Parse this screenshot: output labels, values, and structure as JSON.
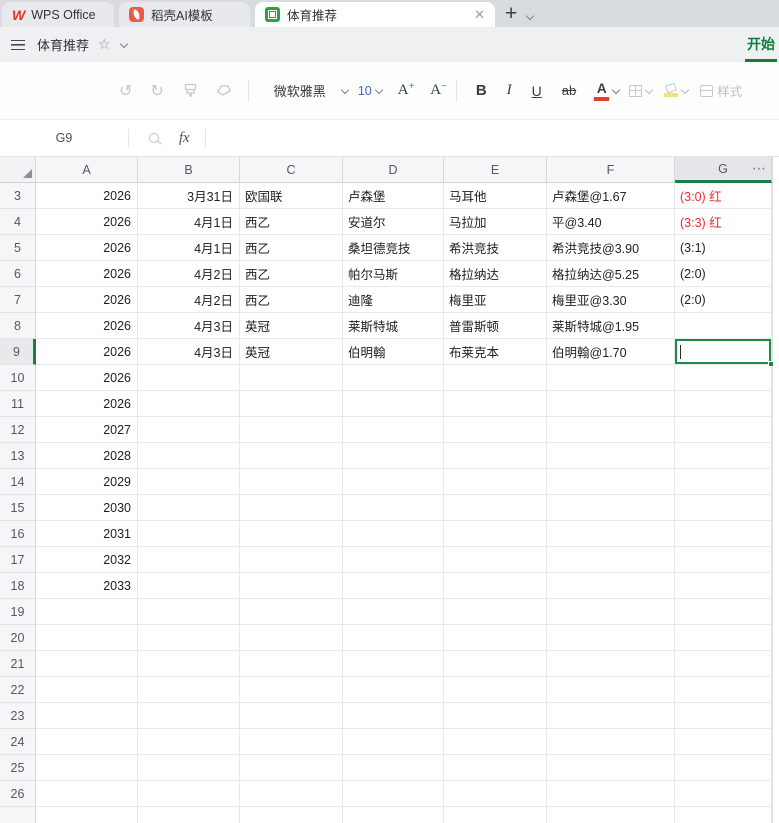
{
  "tabbar": {
    "tabs": [
      {
        "label": "WPS Office",
        "icon": "wps-logo",
        "active": false
      },
      {
        "label": "稻壳AI模板",
        "icon": "docer-template-icon",
        "active": false
      },
      {
        "label": "体育推荐",
        "icon": "spreadsheet-icon",
        "active": true,
        "close_glyph": "✕"
      }
    ],
    "new_tab_glyph": "+"
  },
  "titlebar": {
    "menu_icon": "hamburger",
    "title": "体育推荐",
    "star_glyph": "☆",
    "ribbon_tab": "开始"
  },
  "toolbar": {
    "undo_glyph": "↺",
    "redo_glyph": "↻",
    "font_name": "微软雅黑",
    "font_size": "10",
    "grow_font": "A",
    "grow_sign": "+",
    "shrink_font": "A",
    "shrink_sign": "−",
    "bold": "B",
    "italic": "I",
    "underline": "U",
    "strikethrough": "ab",
    "font_color_letter": "A",
    "font_color": "#e93b2e",
    "fill_color": "#f2e27d",
    "style_label": "样式"
  },
  "formula_bar": {
    "cell_ref": "G9",
    "fx_label": "fx"
  },
  "grid": {
    "columns": [
      "A",
      "B",
      "C",
      "D",
      "E",
      "F",
      "G"
    ],
    "more_button": "⋯",
    "selected_column": "G",
    "selected_cell": "G9",
    "rows": [
      {
        "n": 3,
        "cells": [
          "2026",
          "3月31日",
          "欧国联",
          "卢森堡",
          "马耳他",
          "卢森堡@1.67",
          "(3:0) 红"
        ],
        "result_red": true
      },
      {
        "n": 4,
        "cells": [
          "2026",
          "4月1日",
          "西乙",
          "安道尔",
          "马拉加",
          "平@3.40",
          "(3:3) 红"
        ],
        "result_red": true
      },
      {
        "n": 5,
        "cells": [
          "2026",
          "4月1日",
          "西乙",
          "桑坦德竞技",
          "希洪竞技",
          "希洪竞技@3.90",
          "(3:1)"
        ]
      },
      {
        "n": 6,
        "cells": [
          "2026",
          "4月2日",
          "西乙",
          "帕尔马斯",
          "格拉纳达",
          "格拉纳达@5.25",
          "(2:0)"
        ]
      },
      {
        "n": 7,
        "cells": [
          "2026",
          "4月2日",
          "西乙",
          "迪隆",
          "梅里亚",
          "梅里亚@3.30",
          "(2:0)"
        ]
      },
      {
        "n": 8,
        "cells": [
          "2026",
          "4月3日",
          "英冠",
          "莱斯特城",
          "普雷斯顿",
          "莱斯特城@1.95",
          ""
        ]
      },
      {
        "n": 9,
        "cells": [
          "2026",
          "4月3日",
          "英冠",
          "伯明翰",
          "布莱克本",
          "伯明翰@1.70",
          ""
        ],
        "selected": true
      },
      {
        "n": 10,
        "cells": [
          "2026",
          "",
          "",
          "",
          "",
          "",
          ""
        ]
      },
      {
        "n": 11,
        "cells": [
          "2026",
          "",
          "",
          "",
          "",
          "",
          ""
        ]
      },
      {
        "n": 12,
        "cells": [
          "2027",
          "",
          "",
          "",
          "",
          "",
          ""
        ]
      },
      {
        "n": 13,
        "cells": [
          "2028",
          "",
          "",
          "",
          "",
          "",
          ""
        ]
      },
      {
        "n": 14,
        "cells": [
          "2029",
          "",
          "",
          "",
          "",
          "",
          ""
        ]
      },
      {
        "n": 15,
        "cells": [
          "2030",
          "",
          "",
          "",
          "",
          "",
          ""
        ]
      },
      {
        "n": 16,
        "cells": [
          "2031",
          "",
          "",
          "",
          "",
          "",
          ""
        ]
      },
      {
        "n": 17,
        "cells": [
          "2032",
          "",
          "",
          "",
          "",
          "",
          ""
        ]
      },
      {
        "n": 18,
        "cells": [
          "2033",
          "",
          "",
          "",
          "",
          "",
          ""
        ]
      },
      {
        "n": 19,
        "cells": [
          "",
          "",
          "",
          "",
          "",
          "",
          ""
        ]
      },
      {
        "n": 20,
        "cells": [
          "",
          "",
          "",
          "",
          "",
          "",
          ""
        ]
      },
      {
        "n": 21,
        "cells": [
          "",
          "",
          "",
          "",
          "",
          "",
          ""
        ]
      },
      {
        "n": 22,
        "cells": [
          "",
          "",
          "",
          "",
          "",
          "",
          ""
        ]
      },
      {
        "n": 23,
        "cells": [
          "",
          "",
          "",
          "",
          "",
          "",
          ""
        ]
      },
      {
        "n": 24,
        "cells": [
          "",
          "",
          "",
          "",
          "",
          "",
          ""
        ]
      },
      {
        "n": 25,
        "cells": [
          "",
          "",
          "",
          "",
          "",
          "",
          ""
        ]
      },
      {
        "n": 26,
        "cells": [
          "",
          "",
          "",
          "",
          "",
          "",
          ""
        ]
      }
    ]
  },
  "colors": {
    "accent_green": "#17813f",
    "red_text": "#f22b2b",
    "wps_red": "#e03426",
    "sheet_green": "#23a83e"
  }
}
